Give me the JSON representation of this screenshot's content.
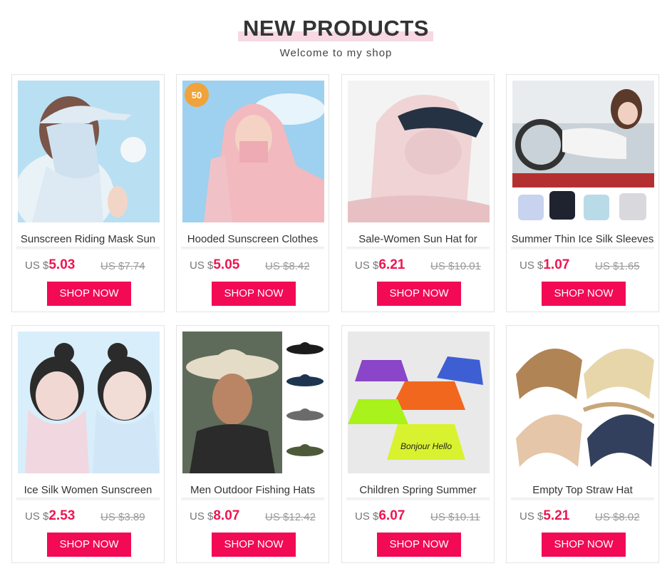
{
  "header": {
    "title": "NEW PRODUCTS",
    "subtitle": "Welcome to my shop"
  },
  "products": [
    {
      "name": "Sunscreen Riding Mask Sun",
      "currency": "US $",
      "price": "5.03",
      "old_price": "US $7.74",
      "button": "SHOP NOW"
    },
    {
      "name": "Hooded Sunscreen Clothes",
      "currency": "US $",
      "price": "5.05",
      "old_price": "US $8.42",
      "button": "SHOP NOW",
      "badge": "50"
    },
    {
      "name": "Sale-Women Sun Hat for",
      "currency": "US $",
      "price": "6.21",
      "old_price": "US $10.01",
      "button": "SHOP NOW"
    },
    {
      "name": "Summer Thin Ice Silk Sleeves",
      "currency": "US $",
      "price": "1.07",
      "old_price": "US $1.65",
      "button": "SHOP NOW"
    },
    {
      "name": "Ice Silk Women Sunscreen",
      "currency": "US $",
      "price": "2.53",
      "old_price": "US $3.89",
      "button": "SHOP NOW"
    },
    {
      "name": "Men Outdoor Fishing Hats",
      "currency": "US $",
      "price": "8.07",
      "old_price": "US $12.42",
      "button": "SHOP NOW"
    },
    {
      "name": "Children Spring Summer",
      "currency": "US $",
      "price": "6.07",
      "old_price": "US $10.11",
      "button": "SHOP NOW",
      "hat_text": "Bonjour Hello"
    },
    {
      "name": "Empty Top Straw Hat",
      "currency": "US $",
      "price": "5.21",
      "old_price": "US $8.02",
      "button": "SHOP NOW"
    }
  ],
  "colors": {
    "accent": "#f20a54",
    "price": "#ee1550",
    "title_highlight": "#f6d9e2"
  }
}
